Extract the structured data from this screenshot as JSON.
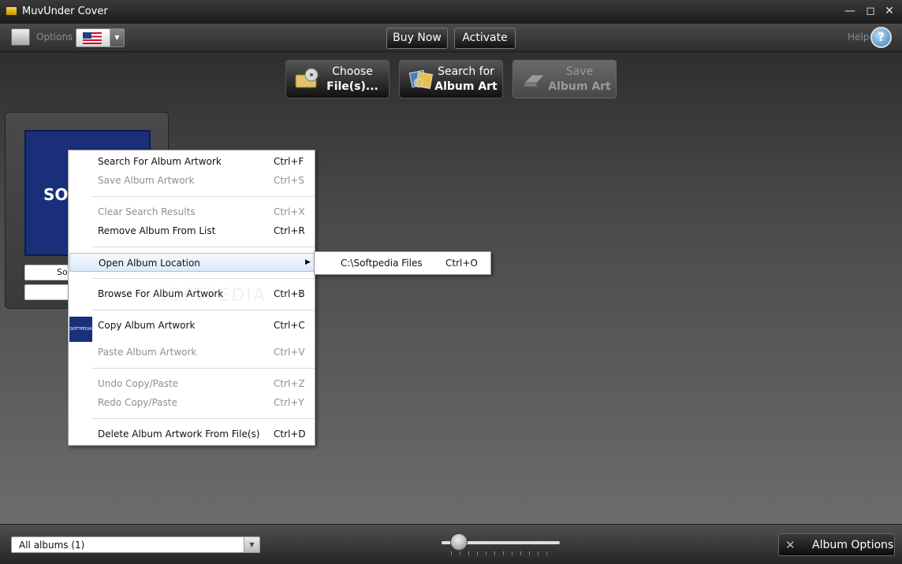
{
  "window": {
    "title": "MuvUnder Cover",
    "minimize_glyph": "—",
    "maximize_glyph": "◻",
    "close_glyph": "✕"
  },
  "toolbar": {
    "options_label": "Options",
    "language_flag": "us-flag-icon",
    "buy_now_label": "Buy Now",
    "activate_label": "Activate",
    "help_label": "Help",
    "help_glyph": "?"
  },
  "actions": {
    "choose": {
      "line1": "Choose",
      "line2": "File(s)..."
    },
    "search": {
      "line1": "Search for",
      "line2": "Album Art"
    },
    "save": {
      "line1": "Save",
      "line2": "Album Art"
    }
  },
  "album_card": {
    "art_text": "SOF",
    "field1": "Sof",
    "field2": ""
  },
  "context_menu": {
    "items": [
      {
        "label": "Search For Album Artwork",
        "shortcut": "Ctrl+F",
        "disabled": false
      },
      {
        "label": "Save Album Artwork",
        "shortcut": "Ctrl+S",
        "disabled": true
      },
      {
        "label": "Clear Search Results",
        "shortcut": "Ctrl+X",
        "disabled": true
      },
      {
        "label": "Remove Album From List",
        "shortcut": "Ctrl+R",
        "disabled": false
      },
      {
        "label": "Open Album Location",
        "shortcut": "",
        "disabled": false
      },
      {
        "label": "Browse For Album Artwork",
        "shortcut": "Ctrl+B",
        "disabled": false
      },
      {
        "label": "Copy Album Artwork",
        "shortcut": "Ctrl+C",
        "disabled": false
      },
      {
        "label": "Paste Album Artwork",
        "shortcut": "Ctrl+V",
        "disabled": true
      },
      {
        "label": "Undo Copy/Paste",
        "shortcut": "Ctrl+Z",
        "disabled": true
      },
      {
        "label": "Redo Copy/Paste",
        "shortcut": "Ctrl+Y",
        "disabled": true
      },
      {
        "label": "Delete Album Artwork From File(s)",
        "shortcut": "Ctrl+D",
        "disabled": false
      }
    ],
    "copy_thumb_text": "SOFTPEDIA",
    "watermark": "SOFTPEDIA"
  },
  "submenu": {
    "label": "C:\\Softpedia Files",
    "shortcut": "Ctrl+O"
  },
  "bottom": {
    "album_filter_value": "All albums (1)",
    "album_options_label": "Album Options",
    "thumbnail_size_fraction": 0.1
  },
  "colors": {
    "accent_highlight": "#dcebf9",
    "album_art_blue": "#1a2f7a"
  }
}
